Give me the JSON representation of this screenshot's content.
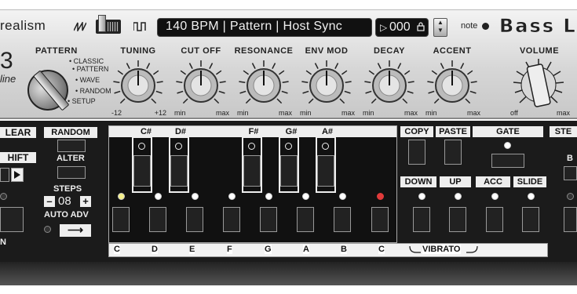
{
  "header": {
    "brand": "realism",
    "model": "Bass L",
    "lcd_text": "140 BPM | Pattern | Host Sync",
    "preset_play": "▷",
    "preset_number": "000",
    "preset_lock": "🔒",
    "note_label": "note",
    "big_digit": "3",
    "line_label": "line"
  },
  "pattern": {
    "title": "PATTERN",
    "options": [
      "CLASSIC",
      "PATTERN",
      "WAVE",
      "RANDOM",
      "SETUP"
    ]
  },
  "knobs": [
    {
      "title": "TUNING",
      "min": "-12",
      "max": "+12"
    },
    {
      "title": "CUT OFF",
      "min": "min",
      "max": "max"
    },
    {
      "title": "RESONANCE",
      "min": "min",
      "max": "max"
    },
    {
      "title": "ENV MOD",
      "min": "min",
      "max": "max"
    },
    {
      "title": "DECAY",
      "min": "min",
      "max": "max"
    },
    {
      "title": "ACCENT",
      "min": "min",
      "max": "max"
    },
    {
      "title": "VOLUME",
      "min": "off",
      "max": "max"
    }
  ],
  "left": {
    "clear": "LEAR",
    "shift": "HIFT",
    "n_label": "N",
    "random": "RANDOM",
    "alter": "ALTER",
    "steps": "STEPS",
    "steps_minus": "–",
    "steps_value": "08",
    "steps_plus": "+",
    "auto_adv": "AUTO ADV",
    "arrow": "⟶"
  },
  "keys": {
    "black_labels": [
      "C#",
      "D#",
      "F#",
      "G#",
      "A#"
    ],
    "white_labels": [
      "C",
      "D",
      "E",
      "F",
      "G",
      "A",
      "B",
      "C"
    ],
    "vibrato": "VIBRATO"
  },
  "right": {
    "copy": "COPY",
    "paste": "PASTE",
    "gate": "GATE",
    "down": "DOWN",
    "up": "UP",
    "acc": "ACC",
    "slide": "SLIDE",
    "ste": "STE",
    "b": "B"
  },
  "colors": {
    "led_yellow": "#f4f08a",
    "led_red": "#e03a3a",
    "panel_silver": "#d6d6d6",
    "panel_dark": "#1b1b1b"
  }
}
